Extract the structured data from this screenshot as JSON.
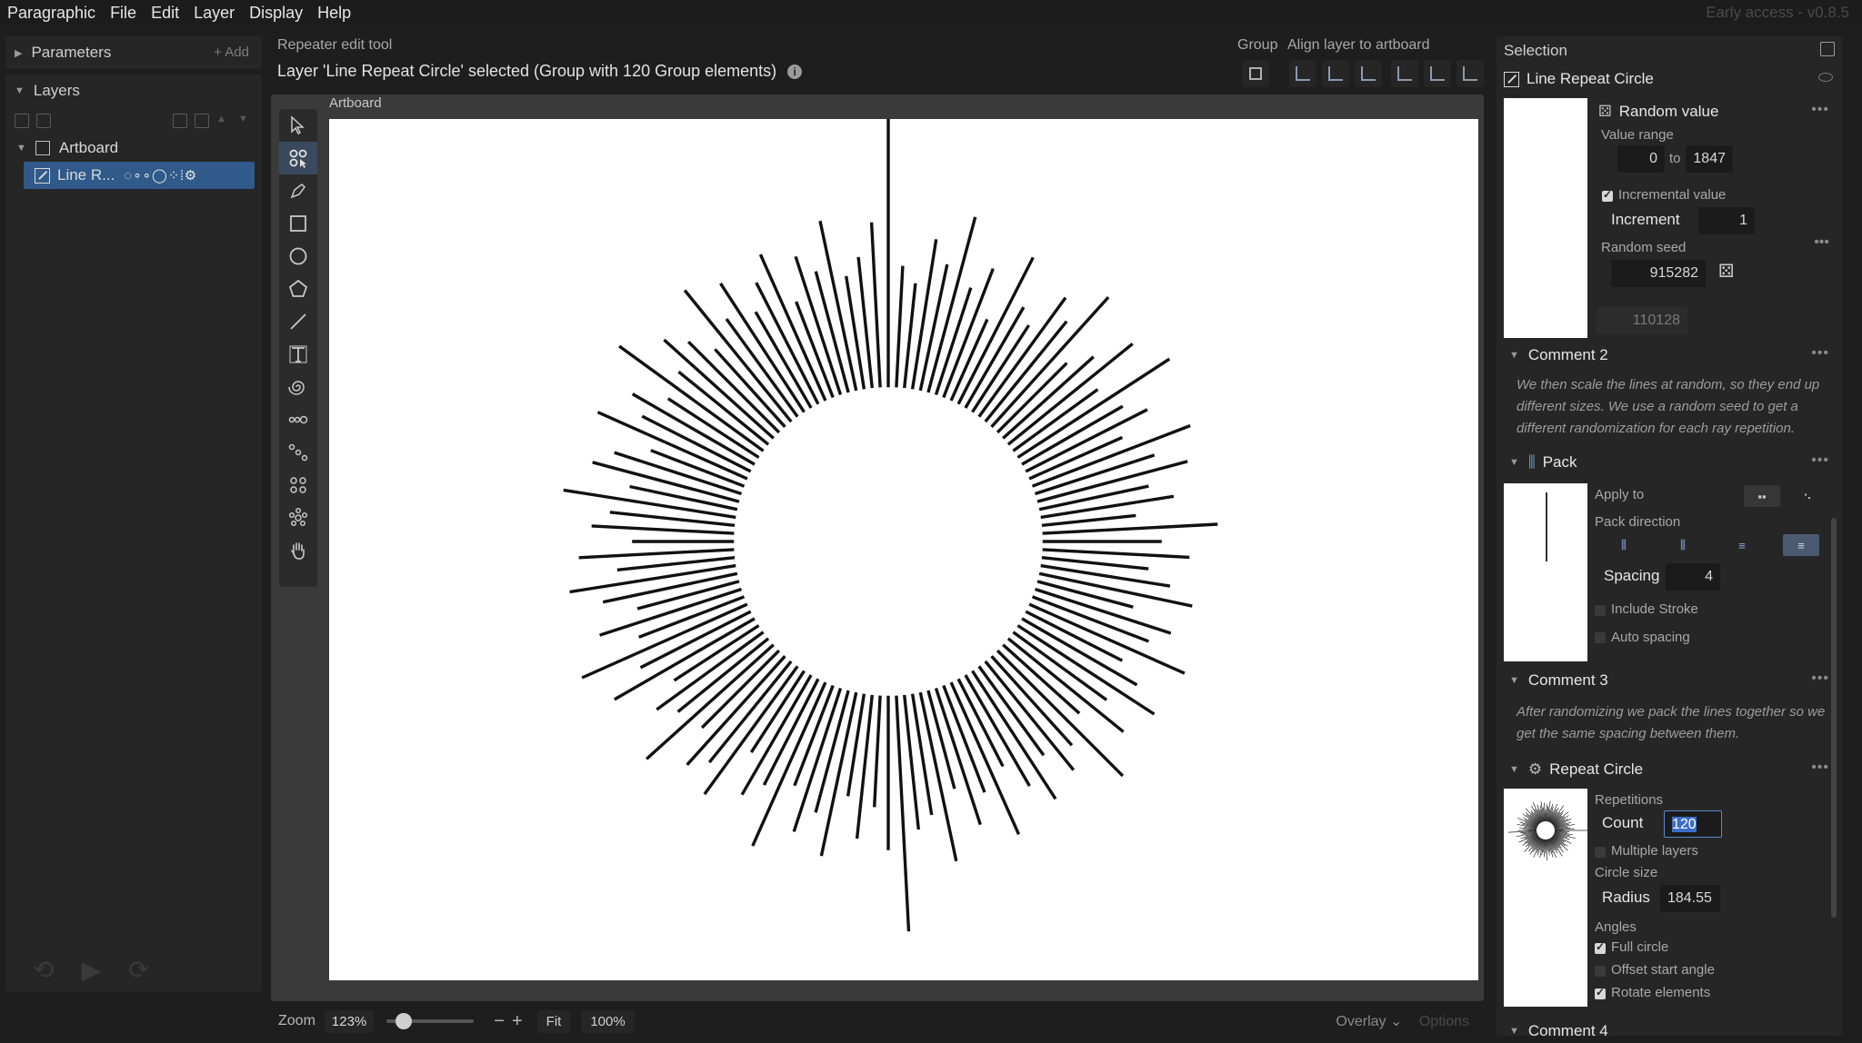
{
  "menubar": {
    "app": "Paragraphic",
    "items": [
      "File",
      "Edit",
      "Layer",
      "Display",
      "Help"
    ],
    "version": "Early access - v0.8.5"
  },
  "left": {
    "parameters": "Parameters",
    "add": "+ Add",
    "layers": "Layers",
    "artboard": "Artboard",
    "line_layer": "Line R...",
    "line_modifiers": "◌∘∘◯⁘⦙⚙"
  },
  "header": {
    "tool": "Repeater edit tool",
    "status": "Layer 'Line Repeat Circle' selected (Group with 120 Group elements)",
    "group": "Group",
    "align": "Align layer to artboard"
  },
  "canvas": {
    "artboard_label": "Artboard",
    "rays": {
      "count": 120,
      "inner_radius": 184.55,
      "lengths": [
        300,
        134,
        116,
        167,
        142,
        200,
        124,
        152,
        98,
        181,
        128,
        114,
        162,
        142,
        192,
        108,
        134,
        176,
        115,
        199,
        128,
        150,
        112,
        186,
        138,
        171,
        123,
        148,
        104,
        193,
        131,
        162,
        118,
        144,
        172,
        109,
        157,
        137,
        187,
        119,
        146,
        179,
        127,
        163,
        113,
        195,
        132,
        154,
        121,
        168,
        141,
        108,
        183,
        126,
        158,
        112,
        190,
        135,
        149,
        260,
        170,
        123,
        159,
        114,
        184,
        139,
        166,
        118,
        197,
        131,
        152,
        107,
        174,
        143,
        161,
        120,
        188,
        128,
        145,
        111,
        178,
        136,
        199,
        124,
        164,
        116,
        151,
        185,
        130,
        171,
        112,
        157,
        138,
        192,
        121,
        167,
        147,
        110,
        180,
        134,
        155,
        119,
        196,
        127,
        162,
        141,
        115,
        186,
        133,
        169,
        122,
        150,
        176,
        113,
        160,
        138,
        191,
        126,
        145,
        182
      ]
    }
  },
  "bottom": {
    "zoom_label": "Zoom",
    "zoom": "123%",
    "minus": "−",
    "plus": "+",
    "fit": "Fit",
    "hundred": "100%",
    "overlay": "Overlay",
    "options": "Options"
  },
  "selection": {
    "title": "Selection",
    "layer": "Line Repeat Circle",
    "random": {
      "title": "Random value",
      "value_range": "Value range",
      "min": "0",
      "to": "to",
      "max": "1847",
      "incremental": "Incremental value",
      "increment_label": "Increment",
      "increment": "1",
      "seed_label": "Random seed",
      "seed": "915282",
      "output": "110128"
    },
    "comment2": {
      "title": "Comment 2",
      "text": "We then scale the lines at random, so they end up different sizes. We use a random seed to get a different randomization for each ray repetition."
    },
    "pack": {
      "title": "Pack",
      "apply_to": "Apply to",
      "direction": "Pack direction",
      "spacing_label": "Spacing",
      "spacing": "4",
      "include_stroke": "Include Stroke",
      "auto_spacing": "Auto spacing"
    },
    "comment3": {
      "title": "Comment 3",
      "text": "After randomizing we pack the lines together so we get the same spacing between them."
    },
    "repeat": {
      "title": "Repeat Circle",
      "repetitions": "Repetitions",
      "count_label": "Count",
      "count": "120",
      "multiple_layers": "Multiple layers",
      "circle_size": "Circle size",
      "radius_label": "Radius",
      "radius": "184.55",
      "angles": "Angles",
      "full_circle": "Full circle",
      "offset_start": "Offset start angle",
      "rotate": "Rotate elements"
    },
    "comment4": {
      "title": "Comment 4"
    }
  }
}
